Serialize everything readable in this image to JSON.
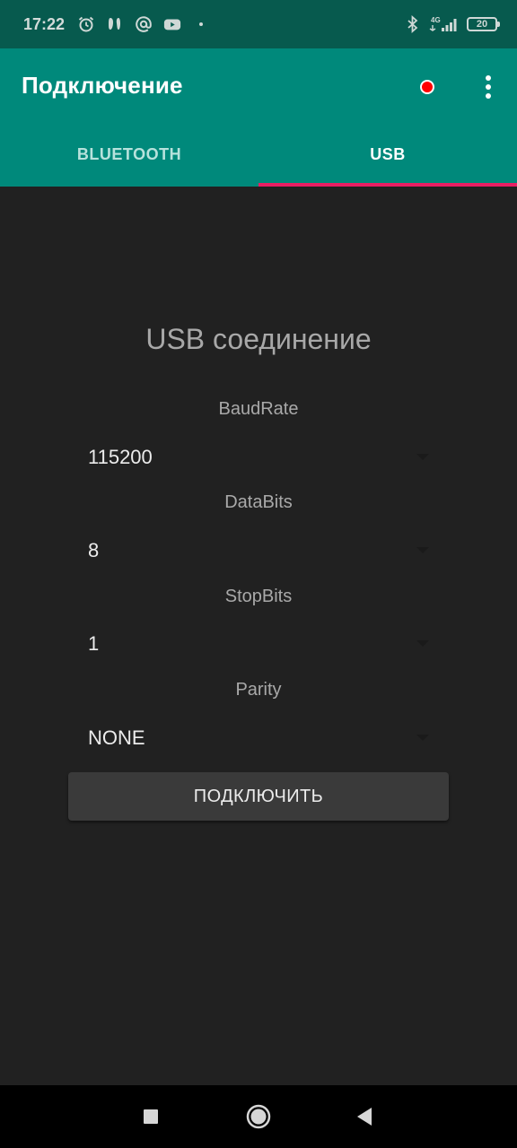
{
  "status_bar": {
    "time": "17:22",
    "left_icons": [
      "alarm-icon",
      "notification-icon",
      "at-sign-icon",
      "youtube-icon",
      "dot-icon"
    ],
    "right_icons": [
      "bluetooth-icon",
      "network-4g-icon",
      "signal-icon"
    ],
    "network_label": "4G",
    "battery_level": "20"
  },
  "app_bar": {
    "title": "Подключение",
    "record_indicator_color": "#ff0000",
    "more_icon": "more-vert-icon"
  },
  "tabs": [
    {
      "label": "BLUETOOTH",
      "active": false
    },
    {
      "label": "USB",
      "active": true
    }
  ],
  "colors": {
    "primary": "#00897b",
    "status_bar": "#075a4e",
    "tab_indicator": "#e91e63",
    "background": "#212121",
    "button_bg": "#3a3a3a"
  },
  "usb": {
    "title": "USB соединение",
    "fields": [
      {
        "label": "BaudRate",
        "value": "115200"
      },
      {
        "label": "DataBits",
        "value": "8"
      },
      {
        "label": "StopBits",
        "value": "1"
      },
      {
        "label": "Parity",
        "value": "NONE"
      }
    ],
    "connect_label": "ПОДКЛЮЧИТЬ"
  },
  "nav_bar": {
    "buttons": [
      "recents-square-icon",
      "home-circle-icon",
      "back-triangle-icon"
    ]
  }
}
